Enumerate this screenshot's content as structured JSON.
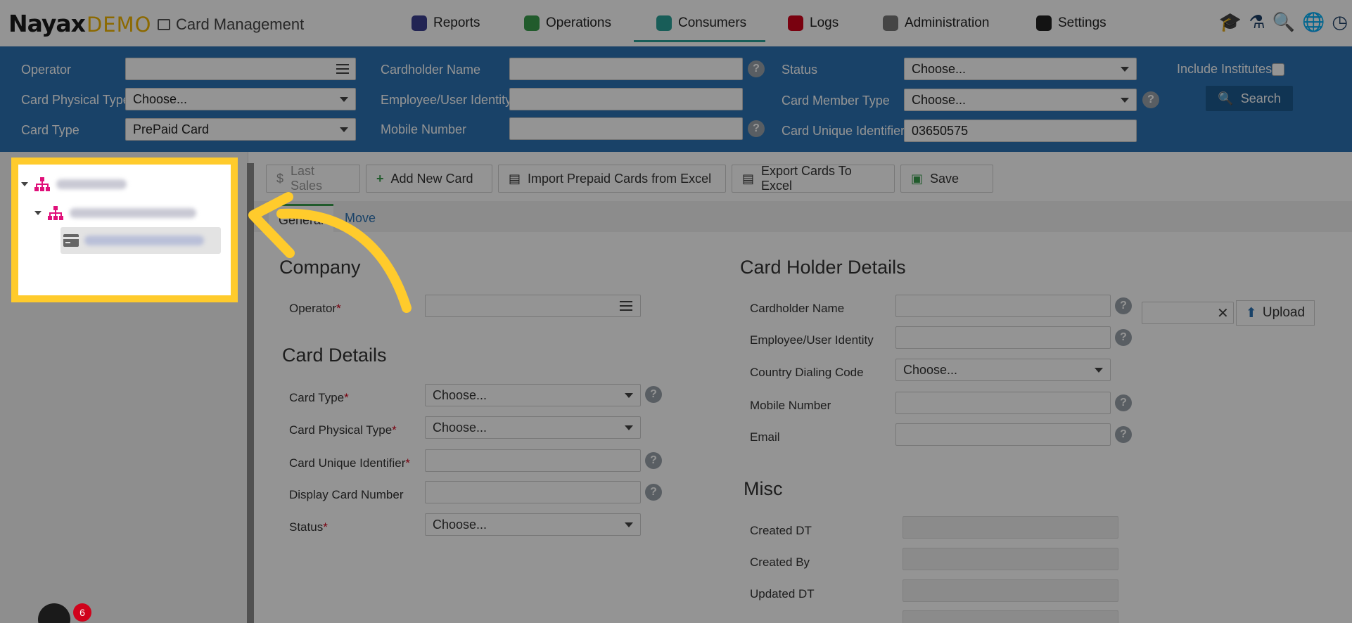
{
  "brand": {
    "name": "Nayax",
    "suffix": "DEMO",
    "app_title": "Card Management"
  },
  "nav": [
    {
      "label": "Reports",
      "icon": "reports-icon",
      "color": "#3b3f8f"
    },
    {
      "label": "Operations",
      "icon": "operations-icon",
      "color": "#3a9d4c"
    },
    {
      "label": "Consumers",
      "icon": "consumers-icon",
      "color": "#2aa198"
    },
    {
      "label": "Logs",
      "icon": "logs-icon",
      "color": "#d0021b"
    },
    {
      "label": "Administration",
      "icon": "administration-icon",
      "color": "#777777"
    },
    {
      "label": "Settings",
      "icon": "settings-icon",
      "color": "#222222"
    }
  ],
  "active_nav": "Consumers",
  "util_icons": [
    "graduation-cap-icon",
    "flask-icon",
    "search-icon",
    "globe-icon",
    "clock-icon"
  ],
  "filters": {
    "operator_label": "Operator",
    "operator_value": "",
    "card_physical_type_label": "Card Physical Type",
    "card_physical_type_value": "Choose...",
    "card_type_label": "Card Type",
    "card_type_value": "PrePaid Card",
    "cardholder_name_label": "Cardholder Name",
    "employee_identity_label": "Employee/User Identity",
    "mobile_number_label": "Mobile Number",
    "status_label": "Status",
    "status_value": "Choose...",
    "card_member_type_label": "Card Member Type",
    "card_member_type_value": "Choose...",
    "card_unique_identifier_label": "Card Unique Identifier",
    "card_unique_identifier_value": "03650575",
    "include_institutes_label": "Include Institutes",
    "search_label": "Search"
  },
  "toolbar": {
    "last_sales": "Last Sales",
    "add_new_card": "Add New Card",
    "import_prepaid": "Import Prepaid Cards from Excel",
    "export_cards": "Export Cards To Excel",
    "save": "Save"
  },
  "tabs": {
    "general": "General",
    "move": "Move"
  },
  "company": {
    "title": "Company",
    "operator_label": "Operator"
  },
  "card_details": {
    "title": "Card Details",
    "card_type_label": "Card Type",
    "card_type_value": "Choose...",
    "card_physical_type_label": "Card Physical Type",
    "card_physical_type_value": "Choose...",
    "card_unique_identifier_label": "Card Unique Identifier",
    "display_card_number_label": "Display Card Number",
    "status_label": "Status",
    "status_value": "Choose..."
  },
  "card_holder": {
    "title": "Card Holder Details",
    "cardholder_name_label": "Cardholder Name",
    "employee_identity_label": "Employee/User Identity",
    "country_code_label": "Country Dialing Code",
    "country_code_value": "Choose...",
    "mobile_number_label": "Mobile Number",
    "email_label": "Email",
    "upload_label": "Upload"
  },
  "misc": {
    "title": "Misc",
    "created_dt_label": "Created DT",
    "created_by_label": "Created By",
    "updated_dt_label": "Updated DT"
  },
  "notifications": {
    "count": "6"
  },
  "colors": {
    "highlight": "#ffcb2c",
    "filterbar": "#2c73b3",
    "tree_icon": "#e0107a"
  }
}
